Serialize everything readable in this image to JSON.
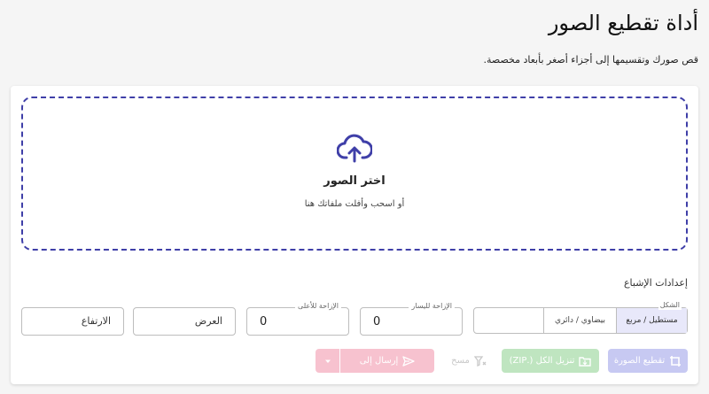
{
  "header": {
    "title": "أداة تقطيع الصور",
    "subtitle": "قص صورك وتقسيمها إلى أجزاء أصغر بأبعاد مخصصة."
  },
  "dropzone": {
    "icon": "cloud-upload-icon",
    "title": "اختر الصور",
    "hint": "أو اسحب وأفلت ملفاتك هنا"
  },
  "settings": {
    "title": "إعدادات الإشباع",
    "shape": {
      "label": "الشكل",
      "options": [
        "مستطيل / مربع",
        "بيضاوي / دائري",
        ""
      ],
      "selected": "مستطيل / مربع"
    },
    "offset_x": {
      "label": "الإزاحة لليسار",
      "value": "0"
    },
    "offset_y": {
      "label": "الإزاحة للأعلى",
      "value": "0"
    },
    "width": {
      "placeholder": "العرض"
    },
    "height": {
      "placeholder": "الارتفاع"
    }
  },
  "actions": {
    "crop_label": "تقطيع الصورة",
    "zip_label": "تنزيل الكل (.ZIP)",
    "clear_label": "مسح",
    "send_label": "إرسال إلى"
  },
  "colors": {
    "accent": "#3f3fa8",
    "crop_disabled": "#c7c9f2",
    "zip_disabled": "#bfe5c0",
    "send_disabled": "#f7c2cf"
  }
}
